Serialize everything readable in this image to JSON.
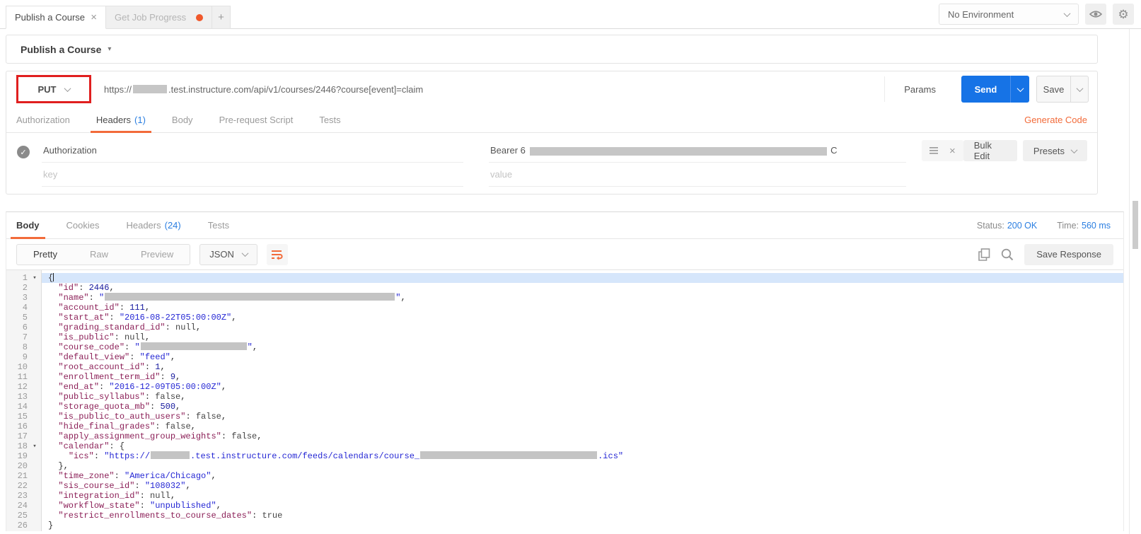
{
  "colors": {
    "accent_orange": "#f26b3a",
    "link_blue": "#2a7ee1",
    "send_blue": "#1673e6",
    "annotation_red": "#e01f1f",
    "unsaved_dot_orange": "#f0582b",
    "redaction_gray": "#c4c4c4"
  },
  "header": {
    "tabs": [
      {
        "label": "Publish a Course",
        "state": "active",
        "close_icon": "x"
      },
      {
        "label": "Get Job Progress",
        "state": "inactive",
        "unsaved_dot": true
      }
    ],
    "new_tab_label": "+",
    "environment_selector": "No Environment",
    "icons": [
      "eye-icon",
      "gear-icon"
    ]
  },
  "request": {
    "title": "Publish a Course",
    "method": "PUT",
    "url": {
      "prefix": "https://",
      "redacted_segment": true,
      "suffix": ".test.instructure.com/api/v1/courses/2446?course[event]=claim"
    },
    "params_button": "Params",
    "send_button": "Send",
    "save_button": "Save",
    "tabs": [
      {
        "label": "Authorization"
      },
      {
        "label": "Headers",
        "count": "(1)",
        "active": true
      },
      {
        "label": "Body"
      },
      {
        "label": "Pre-request Script"
      },
      {
        "label": "Tests"
      }
    ],
    "generate_code_link": "Generate Code",
    "headers_editor": {
      "row": {
        "enabled": true,
        "key": "Authorization",
        "value_prefix": "Bearer 6",
        "value_redacted": true,
        "value_suffix": "C"
      },
      "key_placeholder": "key",
      "value_placeholder": "value",
      "bulk_edit_button": "Bulk Edit",
      "presets_button": "Presets"
    }
  },
  "response": {
    "tabs": [
      {
        "label": "Body",
        "active": true
      },
      {
        "label": "Cookies"
      },
      {
        "label": "Headers",
        "count": "(24)"
      },
      {
        "label": "Tests"
      }
    ],
    "status_label": "Status:",
    "status_value": "200 OK",
    "time_label": "Time:",
    "time_value": "560 ms",
    "view_tabs": [
      {
        "label": "Pretty",
        "active": true
      },
      {
        "label": "Raw"
      },
      {
        "label": "Preview"
      }
    ],
    "format_selector": "JSON",
    "save_response_button": "Save Response",
    "code": {
      "language": "json",
      "lines": [
        {
          "n": 1,
          "fold": true,
          "active": true,
          "t": [
            [
              "p",
              "{"
            ],
            [
              "c",
              ""
            ]
          ]
        },
        {
          "n": 2,
          "t": [
            [
              "w",
              "  "
            ],
            [
              "k",
              "\"id\""
            ],
            [
              "p",
              ": "
            ],
            [
              "d",
              "2446"
            ],
            [
              "p",
              ","
            ]
          ]
        },
        {
          "n": 3,
          "t": [
            [
              "w",
              "  "
            ],
            [
              "k",
              "\"name\""
            ],
            [
              "p",
              ": "
            ],
            [
              "s",
              "\""
            ],
            [
              "r",
              410
            ],
            [
              "s",
              "\""
            ],
            [
              "p",
              ","
            ]
          ]
        },
        {
          "n": 4,
          "t": [
            [
              "w",
              "  "
            ],
            [
              "k",
              "\"account_id\""
            ],
            [
              "p",
              ": "
            ],
            [
              "d",
              "111"
            ],
            [
              "p",
              ","
            ]
          ]
        },
        {
          "n": 5,
          "t": [
            [
              "w",
              "  "
            ],
            [
              "k",
              "\"start_at\""
            ],
            [
              "p",
              ": "
            ],
            [
              "s",
              "\"2016-08-22T05:00:00Z\""
            ],
            [
              "p",
              ","
            ]
          ]
        },
        {
          "n": 6,
          "t": [
            [
              "w",
              "  "
            ],
            [
              "k",
              "\"grading_standard_id\""
            ],
            [
              "p",
              ": "
            ],
            [
              "u",
              "null"
            ],
            [
              "p",
              ","
            ]
          ]
        },
        {
          "n": 7,
          "t": [
            [
              "w",
              "  "
            ],
            [
              "k",
              "\"is_public\""
            ],
            [
              "p",
              ": "
            ],
            [
              "u",
              "null"
            ],
            [
              "p",
              ","
            ]
          ]
        },
        {
          "n": 8,
          "t": [
            [
              "w",
              "  "
            ],
            [
              "k",
              "\"course_code\""
            ],
            [
              "p",
              ": "
            ],
            [
              "s",
              "\""
            ],
            [
              "r",
              150
            ],
            [
              "s",
              "\""
            ],
            [
              "p",
              ","
            ]
          ]
        },
        {
          "n": 9,
          "t": [
            [
              "w",
              "  "
            ],
            [
              "k",
              "\"default_view\""
            ],
            [
              "p",
              ": "
            ],
            [
              "s",
              "\"feed\""
            ],
            [
              "p",
              ","
            ]
          ]
        },
        {
          "n": 10,
          "t": [
            [
              "w",
              "  "
            ],
            [
              "k",
              "\"root_account_id\""
            ],
            [
              "p",
              ": "
            ],
            [
              "d",
              "1"
            ],
            [
              "p",
              ","
            ]
          ]
        },
        {
          "n": 11,
          "t": [
            [
              "w",
              "  "
            ],
            [
              "k",
              "\"enrollment_term_id\""
            ],
            [
              "p",
              ": "
            ],
            [
              "d",
              "9"
            ],
            [
              "p",
              ","
            ]
          ]
        },
        {
          "n": 12,
          "t": [
            [
              "w",
              "  "
            ],
            [
              "k",
              "\"end_at\""
            ],
            [
              "p",
              ": "
            ],
            [
              "s",
              "\"2016-12-09T05:00:00Z\""
            ],
            [
              "p",
              ","
            ]
          ]
        },
        {
          "n": 13,
          "t": [
            [
              "w",
              "  "
            ],
            [
              "k",
              "\"public_syllabus\""
            ],
            [
              "p",
              ": "
            ],
            [
              "u",
              "false"
            ],
            [
              "p",
              ","
            ]
          ]
        },
        {
          "n": 14,
          "t": [
            [
              "w",
              "  "
            ],
            [
              "k",
              "\"storage_quota_mb\""
            ],
            [
              "p",
              ": "
            ],
            [
              "d",
              "500"
            ],
            [
              "p",
              ","
            ]
          ]
        },
        {
          "n": 15,
          "t": [
            [
              "w",
              "  "
            ],
            [
              "k",
              "\"is_public_to_auth_users\""
            ],
            [
              "p",
              ": "
            ],
            [
              "u",
              "false"
            ],
            [
              "p",
              ","
            ]
          ]
        },
        {
          "n": 16,
          "t": [
            [
              "w",
              "  "
            ],
            [
              "k",
              "\"hide_final_grades\""
            ],
            [
              "p",
              ": "
            ],
            [
              "u",
              "false"
            ],
            [
              "p",
              ","
            ]
          ]
        },
        {
          "n": 17,
          "t": [
            [
              "w",
              "  "
            ],
            [
              "k",
              "\"apply_assignment_group_weights\""
            ],
            [
              "p",
              ": "
            ],
            [
              "u",
              "false"
            ],
            [
              "p",
              ","
            ]
          ]
        },
        {
          "n": 18,
          "fold": true,
          "t": [
            [
              "w",
              "  "
            ],
            [
              "k",
              "\"calendar\""
            ],
            [
              "p",
              ": {"
            ]
          ]
        },
        {
          "n": 19,
          "t": [
            [
              "w",
              "    "
            ],
            [
              "k",
              "\"ics\""
            ],
            [
              "p",
              ": "
            ],
            [
              "s",
              "\"https://"
            ],
            [
              "r",
              55
            ],
            [
              "s",
              ".test.instructure.com/feeds/calendars/course_"
            ],
            [
              "r",
              250
            ],
            [
              "s",
              ".ics\""
            ]
          ]
        },
        {
          "n": 20,
          "t": [
            [
              "w",
              "  "
            ],
            [
              "p",
              "},"
            ]
          ]
        },
        {
          "n": 21,
          "t": [
            [
              "w",
              "  "
            ],
            [
              "k",
              "\"time_zone\""
            ],
            [
              "p",
              ": "
            ],
            [
              "s",
              "\"America/Chicago\""
            ],
            [
              "p",
              ","
            ]
          ]
        },
        {
          "n": 22,
          "t": [
            [
              "w",
              "  "
            ],
            [
              "k",
              "\"sis_course_id\""
            ],
            [
              "p",
              ": "
            ],
            [
              "s",
              "\"108032\""
            ],
            [
              "p",
              ","
            ]
          ]
        },
        {
          "n": 23,
          "t": [
            [
              "w",
              "  "
            ],
            [
              "k",
              "\"integration_id\""
            ],
            [
              "p",
              ": "
            ],
            [
              "u",
              "null"
            ],
            [
              "p",
              ","
            ]
          ]
        },
        {
          "n": 24,
          "t": [
            [
              "w",
              "  "
            ],
            [
              "k",
              "\"workflow_state\""
            ],
            [
              "p",
              ": "
            ],
            [
              "s",
              "\"unpublished\""
            ],
            [
              "p",
              ","
            ]
          ]
        },
        {
          "n": 25,
          "t": [
            [
              "w",
              "  "
            ],
            [
              "k",
              "\"restrict_enrollments_to_course_dates\""
            ],
            [
              "p",
              ": "
            ],
            [
              "u",
              "true"
            ]
          ]
        },
        {
          "n": 26,
          "t": [
            [
              "p",
              "}"
            ]
          ]
        }
      ]
    }
  }
}
